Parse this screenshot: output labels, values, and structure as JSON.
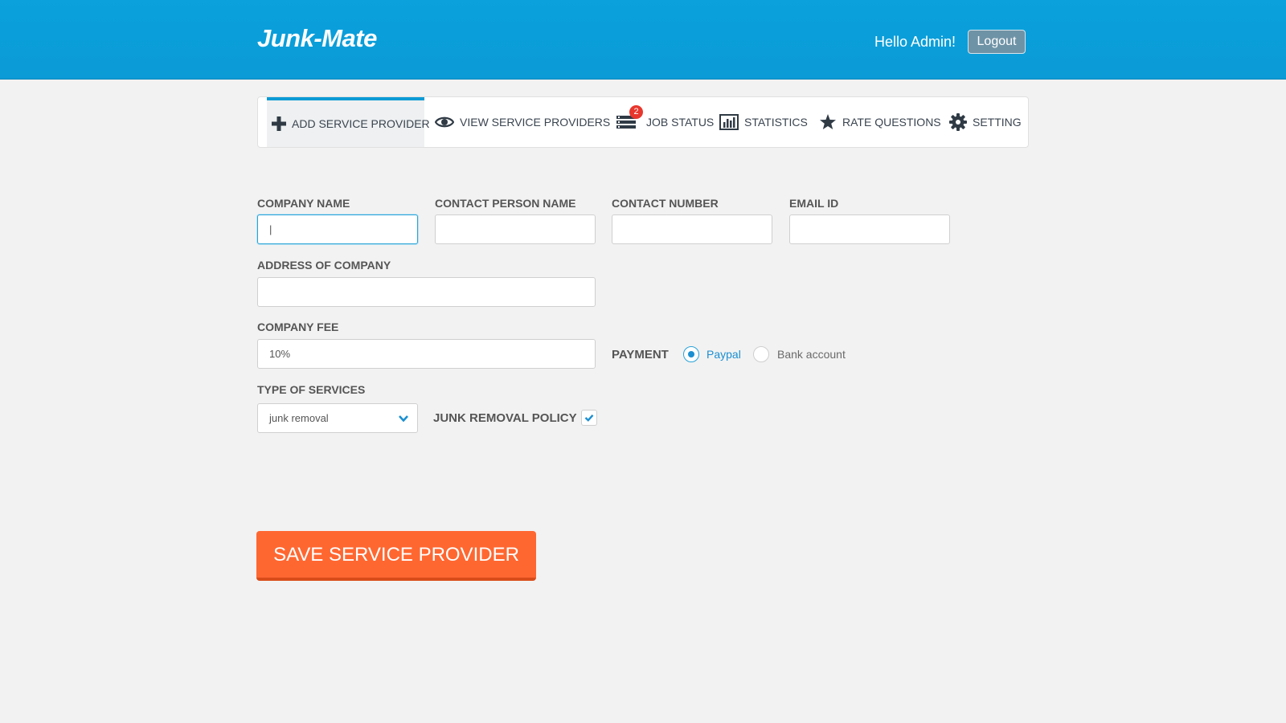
{
  "header": {
    "brand": "Junk-Mate",
    "greeting": "Hello Admin!",
    "logout_label": "Logout"
  },
  "nav": {
    "items": [
      {
        "label": "ADD SERVICE PROVIDER",
        "icon": "plus-icon",
        "active": true
      },
      {
        "label": "VIEW SERVICE PROVIDERS",
        "icon": "eye-icon"
      },
      {
        "label": "JOB STATUS",
        "icon": "list-icon",
        "badge": "2"
      },
      {
        "label": "STATISTICS",
        "icon": "bar-chart-icon"
      },
      {
        "label": "RATE QUESTIONS",
        "icon": "star-icon"
      },
      {
        "label": "SETTING",
        "icon": "gear-icon"
      }
    ]
  },
  "form": {
    "company_name": {
      "label": "COMPANY NAME",
      "value": "|"
    },
    "contact_person": {
      "label": "CONTACT PERSON NAME",
      "value": ""
    },
    "contact_number": {
      "label": "CONTACT NUMBER",
      "value": ""
    },
    "email": {
      "label": "EMAIL ID",
      "value": ""
    },
    "address": {
      "label": "ADDRESS OF COMPANY",
      "value": ""
    },
    "fee": {
      "label": "COMPANY FEE",
      "value": "10%"
    },
    "payment": {
      "label": "PAYMENT",
      "options": [
        {
          "label": "Paypal",
          "selected": true
        },
        {
          "label": "Bank account",
          "selected": false
        }
      ]
    },
    "service_type": {
      "label": "TYPE OF SERVICES",
      "value": "junk removal"
    },
    "policy": {
      "label": "JUNK REMOVAL POLICY",
      "checked": true
    },
    "save_label": "SAVE SERVICE PROVIDER"
  },
  "colors": {
    "header": "#0b9bd6",
    "accent": "#2aa2d8",
    "save_button": "#ff6731",
    "badge": "#e8372d"
  }
}
